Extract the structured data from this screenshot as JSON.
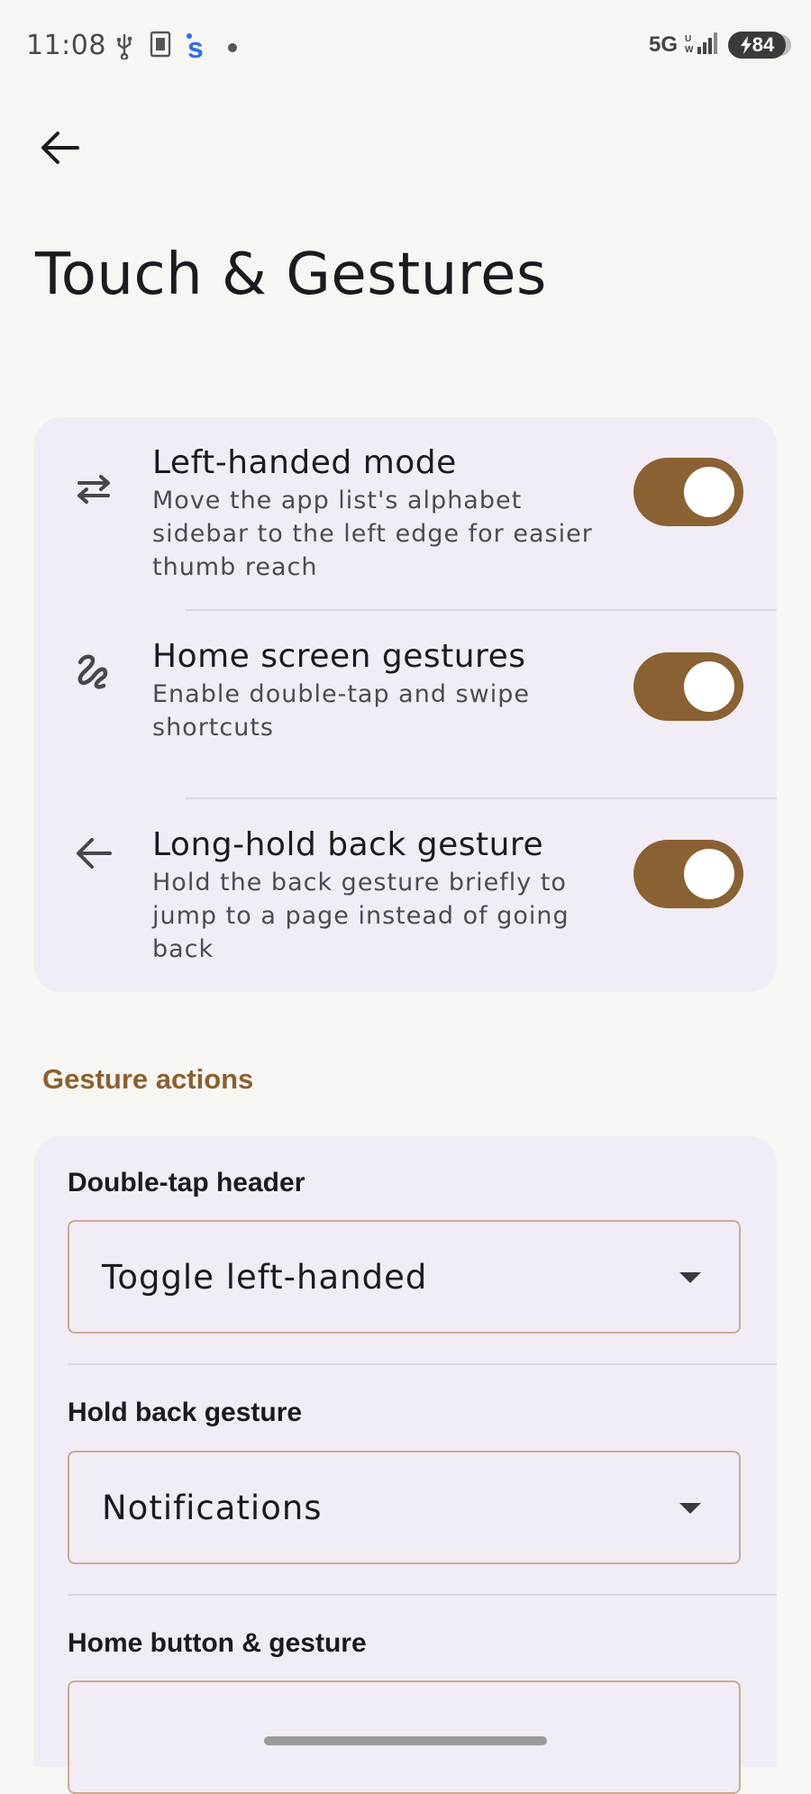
{
  "status_bar": {
    "time": "11:08",
    "network": "5G",
    "battery": "84"
  },
  "page": {
    "title": "Touch & Gestures"
  },
  "toggles": [
    {
      "icon": "swap-arrows-icon",
      "title": "Left-handed mode",
      "subtitle_lines": [
        "Move the app list's alphabet",
        "sidebar to the left edge for easier",
        "thumb reach"
      ],
      "on": true
    },
    {
      "icon": "gesture-icon",
      "title": "Home screen gestures",
      "subtitle_lines": [
        "Enable double-tap and swipe",
        "shortcuts"
      ],
      "on": true
    },
    {
      "icon": "arrow-back-icon",
      "title": "Long-hold back gesture",
      "subtitle_lines": [
        "Hold the back gesture briefly to",
        "jump to a page instead of going",
        "back"
      ],
      "on": true
    }
  ],
  "gesture_actions": {
    "header": "Gesture actions",
    "fields": [
      {
        "label": "Double-tap header",
        "value": "Toggle left-handed"
      },
      {
        "label": "Hold back gesture",
        "value": "Notifications"
      },
      {
        "label": "Home button & gesture",
        "value": ""
      }
    ]
  },
  "colors": {
    "accent": "#8a6132",
    "background": "#f8f6f3",
    "card": "#f1ecf5",
    "field_border": "#c6ad92"
  }
}
